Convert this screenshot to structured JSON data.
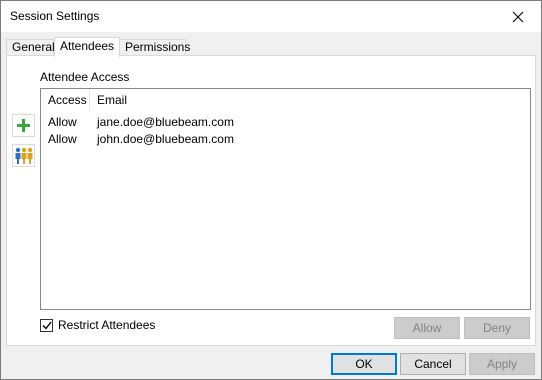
{
  "window": {
    "title": "Session Settings"
  },
  "tabs": [
    {
      "label": "General"
    },
    {
      "label": "Attendees"
    },
    {
      "label": "Permissions"
    }
  ],
  "attendees": {
    "section_label": "Attendee Access",
    "columns": [
      "Access",
      "Email"
    ],
    "rows": [
      {
        "access": "Allow",
        "email": "jane.doe@bluebeam.com"
      },
      {
        "access": "Allow",
        "email": "john.doe@bluebeam.com"
      }
    ],
    "restrict_label": "Restrict Attendees",
    "restrict_checked": true,
    "allow_label": "Allow",
    "deny_label": "Deny"
  },
  "footer": {
    "ok_label": "OK",
    "cancel_label": "Cancel",
    "apply_label": "Apply"
  },
  "icons": {
    "add": "plus-icon",
    "people": "people-icon",
    "close": "close-icon"
  },
  "colors": {
    "add_green": "#3aa53a",
    "accent_blue": "#0078d7"
  }
}
